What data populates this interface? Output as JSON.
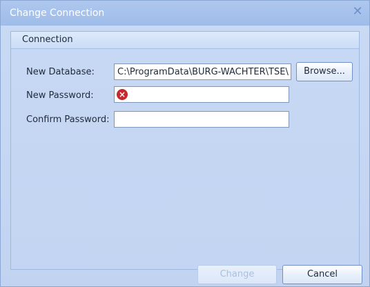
{
  "window": {
    "title": "Change Connection",
    "close_glyph": "✕"
  },
  "group": {
    "title": "Connection"
  },
  "fields": {
    "database_label": "New Database:",
    "database_value": "C:\\ProgramData\\BURG-WACHTER\\TSE\\",
    "browse_label": "Browse...",
    "password_label": "New Password:",
    "password_value": "",
    "password_error_glyph": "×",
    "confirm_label": "Confirm Password:",
    "confirm_value": ""
  },
  "buttons": {
    "change_label": "Change",
    "cancel_label": "Cancel"
  },
  "colors": {
    "error": "#c5282d",
    "accent": "#6f8fc7"
  }
}
